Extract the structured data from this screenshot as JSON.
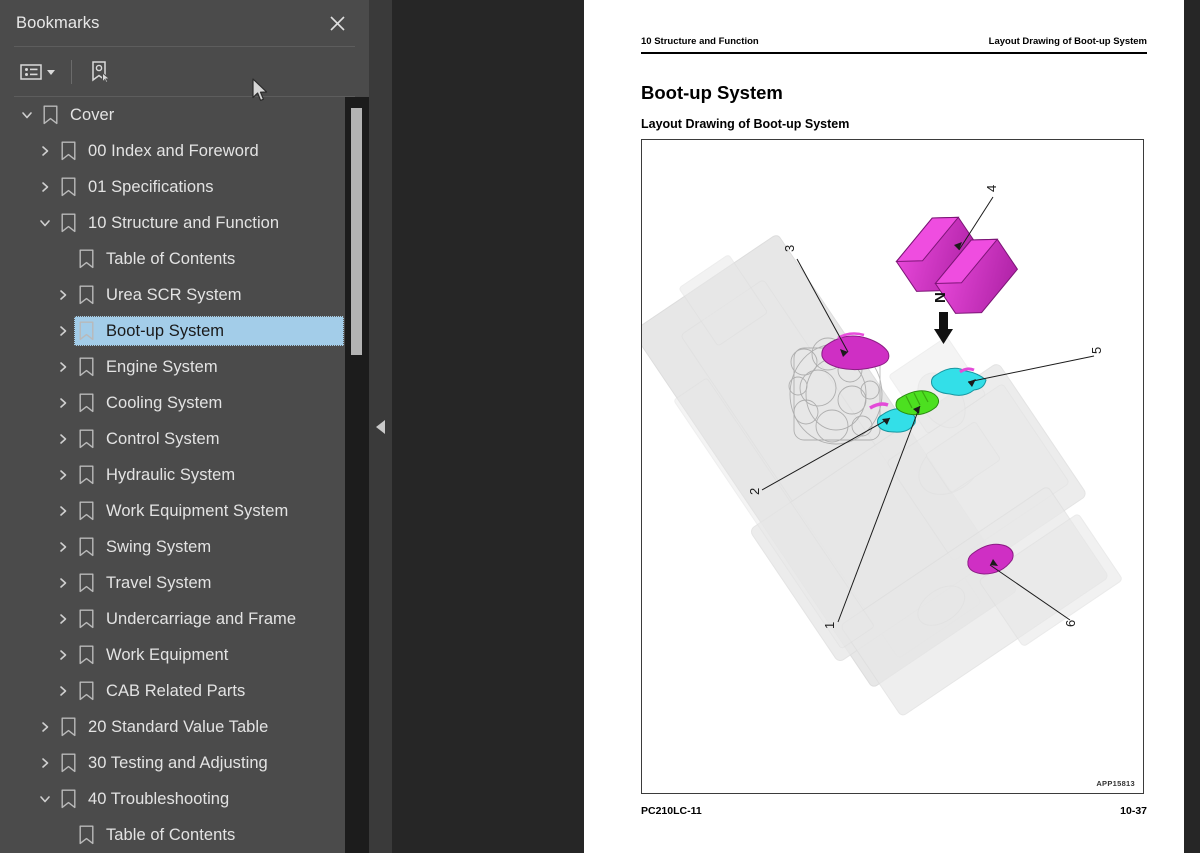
{
  "panel": {
    "title": "Bookmarks",
    "close_icon": "close-icon",
    "toolbar": {
      "options_label": "bookmark-options",
      "options_icon": "list-options-icon",
      "dropdown_icon": "chevron-down-icon",
      "new_bookmark_icon": "new-bookmark-icon"
    },
    "collapse_handle_icon": "chevron-left-icon",
    "selected_item": "Boot-up System",
    "items": [
      {
        "label": "Cover",
        "depth": 0,
        "state": "expanded"
      },
      {
        "label": "00 Index and Foreword",
        "depth": 1,
        "state": "collapsed"
      },
      {
        "label": "01 Specifications",
        "depth": 1,
        "state": "collapsed"
      },
      {
        "label": "10 Structure and Function",
        "depth": 1,
        "state": "expanded"
      },
      {
        "label": "Table of Contents",
        "depth": 2,
        "state": "leaf"
      },
      {
        "label": "Urea SCR System",
        "depth": 2,
        "state": "collapsed"
      },
      {
        "label": "Boot-up System",
        "depth": 2,
        "state": "collapsed",
        "selected": true
      },
      {
        "label": "Engine System",
        "depth": 2,
        "state": "collapsed"
      },
      {
        "label": "Cooling System",
        "depth": 2,
        "state": "collapsed"
      },
      {
        "label": "Control System",
        "depth": 2,
        "state": "collapsed"
      },
      {
        "label": "Hydraulic System",
        "depth": 2,
        "state": "collapsed"
      },
      {
        "label": "Work Equipment System",
        "depth": 2,
        "state": "collapsed"
      },
      {
        "label": "Swing System",
        "depth": 2,
        "state": "collapsed"
      },
      {
        "label": "Travel System",
        "depth": 2,
        "state": "collapsed"
      },
      {
        "label": "Undercarriage and Frame",
        "depth": 2,
        "state": "collapsed"
      },
      {
        "label": "Work Equipment",
        "depth": 2,
        "state": "collapsed"
      },
      {
        "label": "CAB Related Parts",
        "depth": 2,
        "state": "collapsed"
      },
      {
        "label": "20 Standard Value Table",
        "depth": 1,
        "state": "collapsed"
      },
      {
        "label": "30 Testing and Adjusting",
        "depth": 1,
        "state": "collapsed"
      },
      {
        "label": "40 Troubleshooting",
        "depth": 1,
        "state": "expanded"
      },
      {
        "label": "Table of Contents",
        "depth": 2,
        "state": "leaf"
      }
    ]
  },
  "document": {
    "header_left": "10 Structure and Function",
    "header_right": "Layout Drawing of Boot-up System",
    "title": "Boot-up System",
    "subtitle": "Layout Drawing of Boot-up System",
    "figure_id": "APP15813",
    "footer_left": "PC210LC-11",
    "footer_right": "10-37",
    "figure": {
      "orientation_label": "N",
      "callouts": [
        "1",
        "2",
        "3",
        "4",
        "5",
        "6"
      ],
      "colors": {
        "magenta": "#e832d8",
        "magenta_dark": "#b423aa",
        "cyan": "#2ce0e8",
        "green": "#4ce020",
        "ghost": "#c8c8c8"
      }
    }
  },
  "theme": {
    "panel_bg": "#4b4b4b",
    "viewer_bg": "#262626",
    "selection_blue": "#a3cde9",
    "text": "#e3e3e3"
  }
}
